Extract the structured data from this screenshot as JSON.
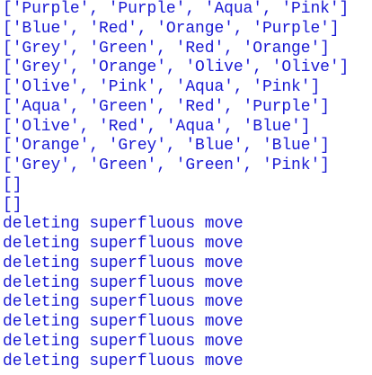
{
  "console": {
    "text_color": "#1a1ad4",
    "background": "#ffffff",
    "lines": [
      "['Purple', 'Purple', 'Aqua', 'Pink']",
      "['Blue', 'Red', 'Orange', 'Purple']",
      "['Grey', 'Green', 'Red', 'Orange']",
      "['Grey', 'Orange', 'Olive', 'Olive']",
      "['Olive', 'Pink', 'Aqua', 'Pink']",
      "['Aqua', 'Green', 'Red', 'Purple']",
      "['Olive', 'Red', 'Aqua', 'Blue']",
      "['Orange', 'Grey', 'Blue', 'Blue']",
      "['Grey', 'Green', 'Green', 'Pink']",
      "[]",
      "[]",
      "deleting superfluous move",
      "deleting superfluous move",
      "deleting superfluous move",
      "deleting superfluous move",
      "deleting superfluous move",
      "deleting superfluous move",
      "deleting superfluous move",
      "deleting superfluous move"
    ]
  }
}
